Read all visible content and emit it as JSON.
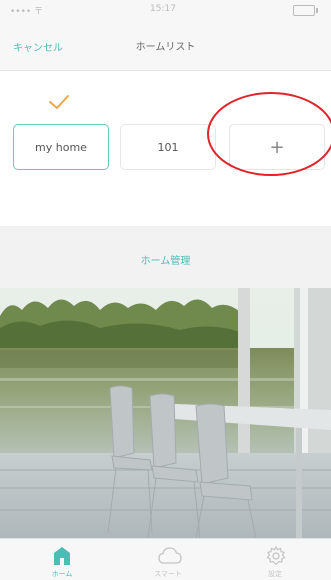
{
  "status_bar": {
    "carrier": "•••• 〒",
    "time": "15:17"
  },
  "nav": {
    "cancel_label": "キャンセル",
    "title": "ホームリスト"
  },
  "homes": [
    {
      "name": "my home",
      "selected": true
    },
    {
      "name": "101",
      "selected": false
    }
  ],
  "add_button": {
    "label": "+"
  },
  "manage": {
    "label": "ホーム管理"
  },
  "tabs": [
    {
      "label": "ホーム",
      "icon": "home-icon",
      "active": true
    },
    {
      "label": "スマート",
      "icon": "cloud-icon",
      "active": false
    },
    {
      "label": "設定",
      "icon": "gear-icon",
      "active": false
    }
  ],
  "colors": {
    "accent": "#4dbcb4",
    "annotation": "#e0242a",
    "check": "#f0a54a"
  }
}
